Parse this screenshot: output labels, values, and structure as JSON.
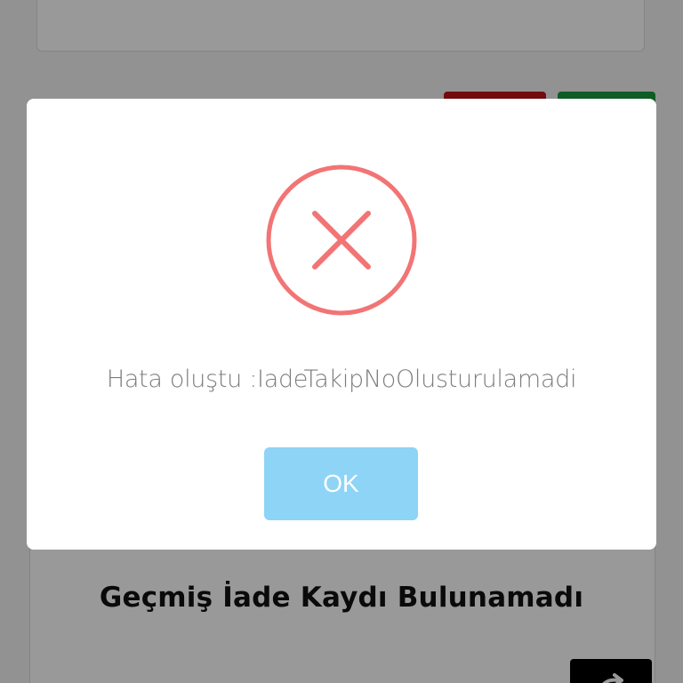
{
  "background": {
    "history_empty_title": "Geçmiş İade Kaydı Bulunamadı",
    "colors": {
      "action_red": "#c0141a",
      "action_green": "#1a9a3f",
      "fab_black": "#000000"
    }
  },
  "dialog": {
    "icon": "error-x-circle-icon",
    "icon_color": "#f27474",
    "message": "Hata oluştu :IadeTakipNoOlusturulamadi",
    "confirm_label": "OK",
    "confirm_color": "#8ed4f6"
  }
}
